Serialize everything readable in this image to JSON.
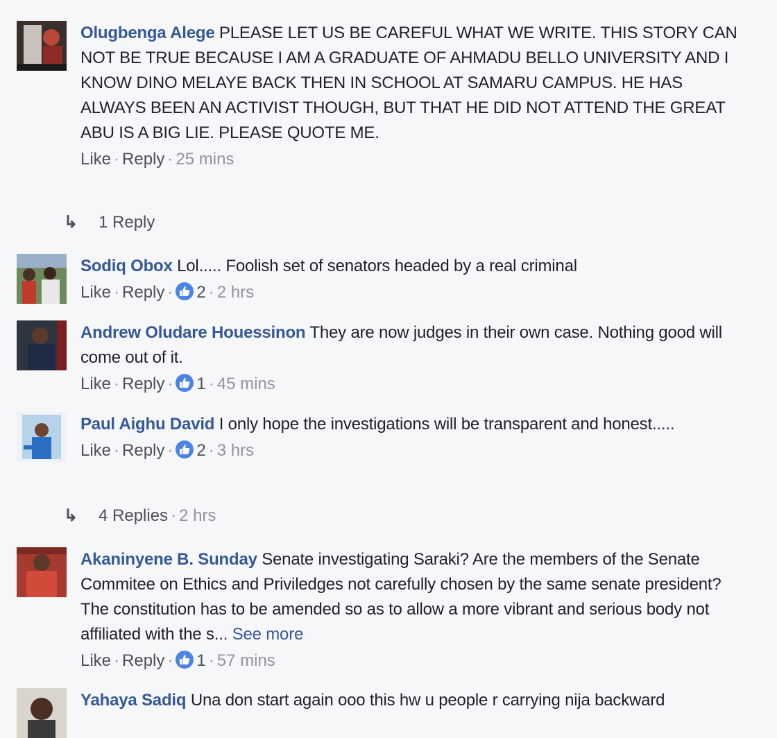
{
  "comments": [
    {
      "author": "Olugbenga Alege",
      "text": " PLEASE LET US BE CAREFUL WHAT WE WRITE. THIS STORY CAN NOT BE TRUE BECAUSE I AM A GRADUATE OF AHMADU BELLO UNIVERSITY AND I KNOW DINO MELAYE BACK THEN IN SCHOOL AT SAMARU CAMPUS. HE HAS ALWAYS BEEN AN ACTIVIST THOUGH, BUT THAT HE DID NOT ATTEND THE GREAT ABU IS A BIG LIE. PLEASE QUOTE ME.",
      "like_label": "Like",
      "reply_label": "Reply",
      "time": "25 mins",
      "replies_label": "1 Reply"
    },
    {
      "author": "Sodiq Obox",
      "text": " Lol..... Foolish set of senators headed by a real criminal",
      "like_label": "Like",
      "reply_label": "Reply",
      "reactions": "2",
      "time": "2 hrs"
    },
    {
      "author": "Andrew Oludare Houessinon",
      "text": " They are now judges in their own case. Nothing good will come out of it.",
      "like_label": "Like",
      "reply_label": "Reply",
      "reactions": "1",
      "time": "45 mins"
    },
    {
      "author": "Paul Aighu David",
      "text": " I only hope the investigations will be transparent and honest.....",
      "like_label": "Like",
      "reply_label": "Reply",
      "reactions": "2",
      "time": "3 hrs",
      "replies_label": "4 Replies",
      "replies_time": "2 hrs"
    },
    {
      "author": "Akaninyene B. Sunday",
      "text": " Senate investigating Saraki? Are the members of the Senate Commitee on Ethics and Priviledges not carefully chosen by the same senate president? The constitution has to be amended so as to allow a more vibrant and serious body not affiliated with the s...",
      "see_more": "See more",
      "like_label": "Like",
      "reply_label": "Reply",
      "reactions": "1",
      "time": "57 mins"
    },
    {
      "author": "Yahaya Sadiq",
      "text": " Una don start again ooo this hw u people r carrying nija backward"
    }
  ],
  "separator": "·",
  "colors": {
    "author": "#365899",
    "meta": "#90949c",
    "like_badge": "#4a84e6",
    "background": "#f6f7f9"
  },
  "icons": {
    "reply_arrow": "reply-arrow-icon",
    "like_badge": "thumbs-up-icon"
  }
}
